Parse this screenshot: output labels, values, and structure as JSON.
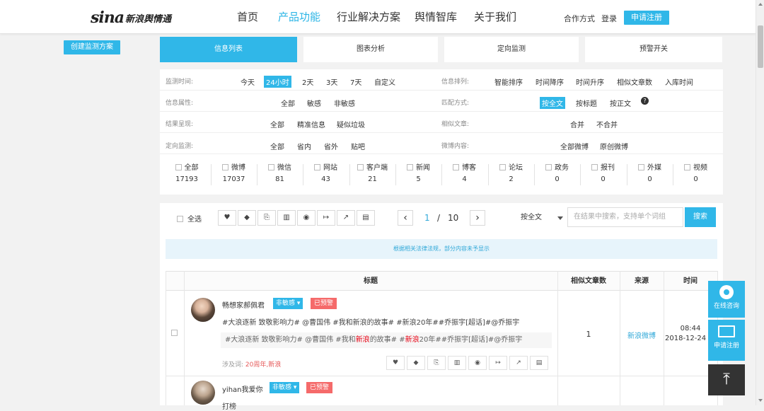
{
  "header": {
    "logo_main": "sina",
    "logo_sub": "新浪舆情通",
    "nav": [
      "首页",
      "产品功能",
      "行业解决方案",
      "舆情智库",
      "关于我们"
    ],
    "links": [
      "合作方式",
      "登录"
    ],
    "register": "申请注册",
    "accent": "#30b7e8"
  },
  "sidebar": {
    "create": "创建监测方案"
  },
  "tabs": [
    "信息列表",
    "图表分析",
    "定向监测",
    "预警开关"
  ],
  "filters": {
    "time_label": "监测时间:",
    "time_opts": [
      "今天",
      "24小时",
      "2天",
      "3天",
      "7天",
      "自定义"
    ],
    "sort_label": "信息排列:",
    "sort_opts": [
      "智能排序",
      "时间降序",
      "时间升序",
      "相似文章数",
      "入库时间"
    ],
    "attr_label": "信息属性:",
    "attr_opts": [
      "全部",
      "敏感",
      "非敏感"
    ],
    "match_label": "匹配方式:",
    "match_opts": [
      "按全文",
      "按标题",
      "按正文"
    ],
    "result_label": "结果呈现:",
    "result_opts": [
      "全部",
      "精准信息",
      "疑似垃圾"
    ],
    "similar_label": "相似文章:",
    "similar_opts": [
      "合并",
      "不合并"
    ],
    "target_label": "定向监测:",
    "target_opts": [
      "全部",
      "省内",
      "省外",
      "贴吧"
    ],
    "weibo_label": "微博内容:",
    "weibo_opts": [
      "全部微博",
      "原创微博"
    ]
  },
  "categories": [
    {
      "label": "全部",
      "count": "17193"
    },
    {
      "label": "微博",
      "count": "17037"
    },
    {
      "label": "微信",
      "count": "81"
    },
    {
      "label": "网站",
      "count": "43"
    },
    {
      "label": "客户端",
      "count": "21"
    },
    {
      "label": "新闻",
      "count": "5"
    },
    {
      "label": "博客",
      "count": "4"
    },
    {
      "label": "论坛",
      "count": "2"
    },
    {
      "label": "政务",
      "count": "0"
    },
    {
      "label": "报刊",
      "count": "0"
    },
    {
      "label": "外媒",
      "count": "0"
    },
    {
      "label": "视频",
      "count": "0"
    }
  ],
  "toolbar": {
    "select_all": "全选",
    "page_current": "1",
    "page_sep": "/",
    "page_total": "10",
    "search_mode": "按全文",
    "search_placeholder": "在结果中搜索，支持单个词组",
    "search_btn": "搜索"
  },
  "notice": "根据相关法律法规，部分内容未予显示",
  "table": {
    "headers": [
      "标题",
      "相似文章数",
      "来源",
      "时间"
    ],
    "rows": [
      {
        "user": "畅想家郝佩君",
        "tag": "非敏感",
        "warn": "已预警",
        "text": "#大浪逐新 致敬影响力# @曹国伟 #我和新浪的故事# #新浪20年##乔振宇[超话]#@乔振宇",
        "quote_a": "#大浪逐新 致敬影响力# @曹国伟 #我和",
        "quote_b": "新浪",
        "quote_c": "的故事# #",
        "quote_d": "新浪",
        "quote_e": "20年##乔振宇[超话]#@乔振宇",
        "rel_label": "涉及词:",
        "rel_words": "20周年,新浪",
        "similar": "1",
        "source": "新浪微博",
        "time": "08:44",
        "date": "2018-12-24"
      },
      {
        "user": "yihan我爱你",
        "tag": "非敏感",
        "warn": "已预警",
        "text": "打榜"
      }
    ]
  },
  "float": {
    "consult": "在线咨询",
    "register": "申请注册"
  }
}
